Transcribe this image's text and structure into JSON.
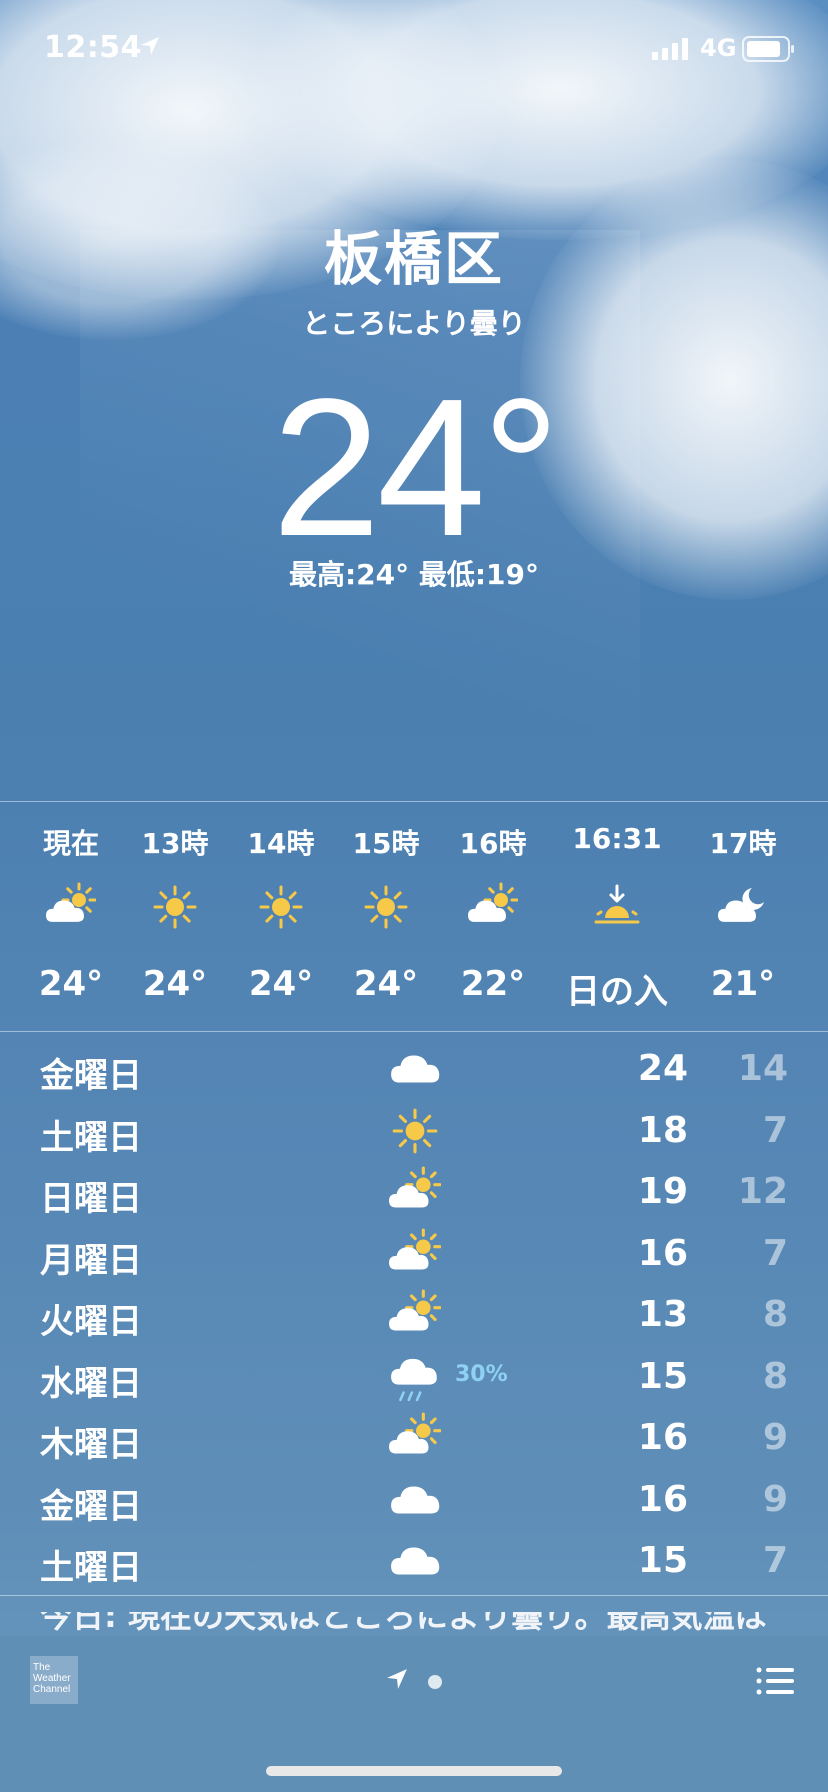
{
  "status_bar": {
    "time": "12:54",
    "network": "4G"
  },
  "header": {
    "city": "板橋区",
    "condition": "ところにより曇り",
    "temperature": "24°",
    "hi_lo": "最高:24° 最低:19°"
  },
  "hourly": [
    {
      "label": "現在",
      "icon": "partly-cloudy-day-icon",
      "temp": "24°"
    },
    {
      "label": "13時",
      "icon": "sun-icon",
      "temp": "24°"
    },
    {
      "label": "14時",
      "icon": "sun-icon",
      "temp": "24°"
    },
    {
      "label": "15時",
      "icon": "sun-icon",
      "temp": "24°"
    },
    {
      "label": "16時",
      "icon": "partly-cloudy-day-icon",
      "temp": "22°"
    },
    {
      "label": "16:31",
      "icon": "sunset-icon",
      "temp": "日の入"
    },
    {
      "label": "17時",
      "icon": "partly-cloudy-night-icon",
      "temp": "21°"
    }
  ],
  "daily": [
    {
      "day": "金曜日",
      "icon": "cloud-icon",
      "precip": "",
      "high": "24",
      "low": "14"
    },
    {
      "day": "土曜日",
      "icon": "sun-icon",
      "precip": "",
      "high": "18",
      "low": "7"
    },
    {
      "day": "日曜日",
      "icon": "partly-cloudy-day-icon",
      "precip": "",
      "high": "19",
      "low": "12"
    },
    {
      "day": "月曜日",
      "icon": "partly-cloudy-day-icon",
      "precip": "",
      "high": "16",
      "low": "7"
    },
    {
      "day": "火曜日",
      "icon": "partly-cloudy-day-icon",
      "precip": "",
      "high": "13",
      "low": "8"
    },
    {
      "day": "水曜日",
      "icon": "rain-icon",
      "precip": "30%",
      "high": "15",
      "low": "8"
    },
    {
      "day": "木曜日",
      "icon": "partly-cloudy-day-icon",
      "precip": "",
      "high": "16",
      "low": "9"
    },
    {
      "day": "金曜日",
      "icon": "cloud-icon",
      "precip": "",
      "high": "16",
      "low": "9"
    },
    {
      "day": "土曜日",
      "icon": "cloud-icon",
      "precip": "",
      "high": "15",
      "low": "7"
    }
  ],
  "summary": "今日: 現在の天気はところにより曇り。最高気温は",
  "bottom_bar": {
    "logo_line1": "The",
    "logo_line2": "Weather",
    "logo_line3": "Channel"
  },
  "colors": {
    "sun": "#f7c948",
    "precip": "#8fd1f2",
    "sky": "#4c80b5"
  }
}
